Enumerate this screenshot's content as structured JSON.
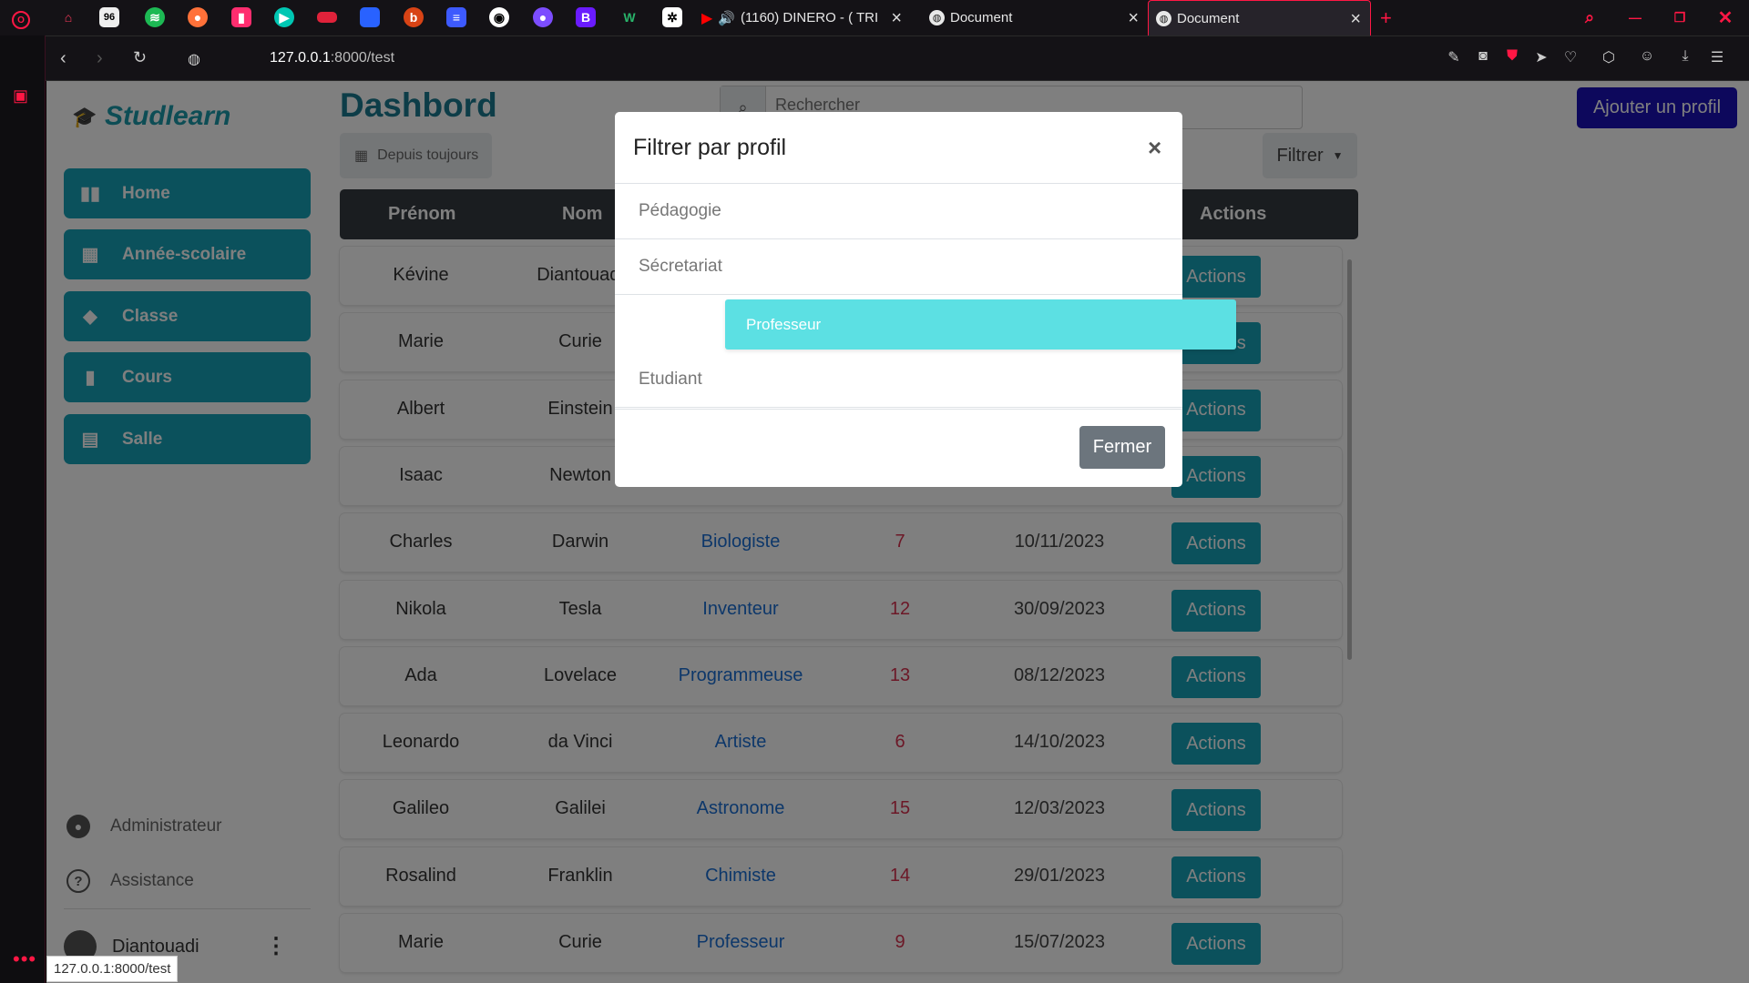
{
  "browser": {
    "tabs": [
      {
        "title": "(1160) DINERO - ( TRI"
      },
      {
        "title": "Document"
      },
      {
        "title": "Document"
      }
    ],
    "url_host": "127.0.0.1",
    "url_path": ":8000/test",
    "status_url": "127.0.0.1:8000/test",
    "pinned_icons": [
      "gamepad-icon",
      "96-icon",
      "spotify-icon",
      "firefox-icon",
      "pink-icon",
      "play-icon",
      "flag-icon",
      "blue-icon",
      "bottle-icon",
      "gradient-icon",
      "github-icon",
      "purple-circle-icon",
      "b-icon",
      "w-icon",
      "chatgpt-icon"
    ],
    "accent_color": "#ff1744"
  },
  "sidebar": {
    "brand": "Studlearn",
    "nav": [
      {
        "label": "Home",
        "icon": "bar-chart-icon"
      },
      {
        "label": "Année-scolaire",
        "icon": "calendar-icon"
      },
      {
        "label": "Classe",
        "icon": "graduation-cap-icon"
      },
      {
        "label": "Cours",
        "icon": "book-icon"
      },
      {
        "label": "Salle",
        "icon": "store-icon"
      }
    ],
    "footer": [
      {
        "label": "Administrateur",
        "icon": "user-circle-icon"
      },
      {
        "label": "Assistance",
        "icon": "help-circle-icon"
      }
    ],
    "user": {
      "name": "Diantouadi"
    }
  },
  "main": {
    "title": "Dashbord",
    "search_placeholder": "Rechercher",
    "date_filter": "Depuis toujours",
    "filter_label": "Filtrer",
    "add_button": "Ajouter un profil",
    "columns": {
      "first": "Prénom",
      "last": "Nom",
      "actions": "Actions"
    },
    "rows": [
      {
        "first": "Kévine",
        "last": "Diantouadi",
        "profession": "",
        "count": "",
        "date": "",
        "action": "Actions"
      },
      {
        "first": "Marie",
        "last": "Curie",
        "profession": "",
        "count": "",
        "date": "",
        "action": "Actions"
      },
      {
        "first": "Albert",
        "last": "Einstein",
        "profession": "",
        "count": "",
        "date": "",
        "action": "Actions"
      },
      {
        "first": "Isaac",
        "last": "Newton",
        "profession": "",
        "count": "",
        "date": "",
        "action": "Actions"
      },
      {
        "first": "Charles",
        "last": "Darwin",
        "profession": "Biologiste",
        "count": "7",
        "date": "10/11/2023",
        "action": "Actions"
      },
      {
        "first": "Nikola",
        "last": "Tesla",
        "profession": "Inventeur",
        "count": "12",
        "date": "30/09/2023",
        "action": "Actions"
      },
      {
        "first": "Ada",
        "last": "Lovelace",
        "profession": "Programmeuse",
        "count": "13",
        "date": "08/12/2023",
        "action": "Actions"
      },
      {
        "first": "Leonardo",
        "last": "da Vinci",
        "profession": "Artiste",
        "count": "6",
        "date": "14/10/2023",
        "action": "Actions"
      },
      {
        "first": "Galileo",
        "last": "Galilei",
        "profession": "Astronome",
        "count": "15",
        "date": "12/03/2023",
        "action": "Actions"
      },
      {
        "first": "Rosalind",
        "last": "Franklin",
        "profession": "Chimiste",
        "count": "14",
        "date": "29/01/2023",
        "action": "Actions"
      },
      {
        "first": "Marie",
        "last": "Curie",
        "profession": "Professeur",
        "count": "9",
        "date": "15/07/2023",
        "action": "Actions"
      }
    ]
  },
  "modal": {
    "title": "Filtrer par profil",
    "close_symbol": "×",
    "options": [
      {
        "label": "Pédagogie",
        "active": false
      },
      {
        "label": "Sécretariat",
        "active": false
      },
      {
        "label": "Professeur",
        "active": true
      },
      {
        "label": "Etudiant",
        "active": false
      }
    ],
    "close_button": "Fermer"
  }
}
